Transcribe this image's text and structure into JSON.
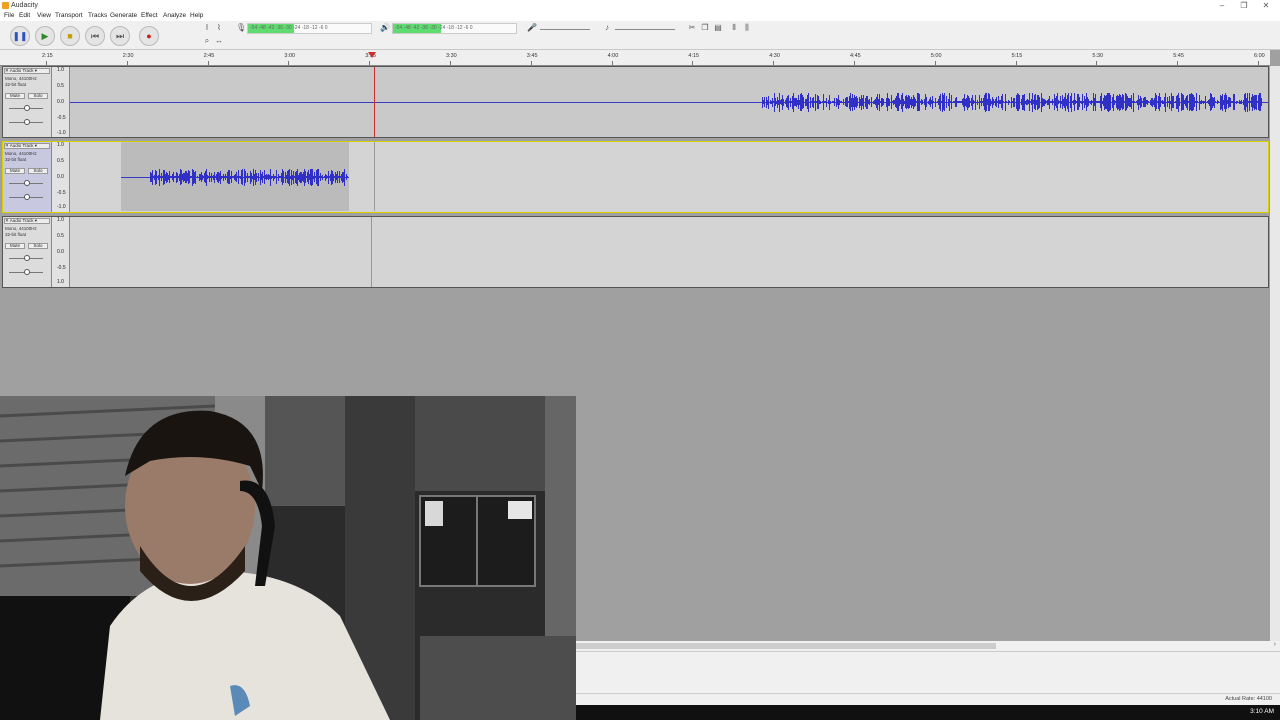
{
  "window": {
    "title": "Audacity",
    "controls": [
      "–",
      "❐",
      "✕"
    ]
  },
  "menu": [
    "File",
    "Edit",
    "View",
    "Transport",
    "Tracks",
    "Generate",
    "Effect",
    "Analyze",
    "Help"
  ],
  "toolbar": {
    "pause": "❚❚",
    "play": "▶",
    "stop": "■",
    "skip_start": "⏮",
    "skip_end": "⏭",
    "record": "●",
    "record_meter_scale": "-54 -48 -42 -36 -30 -24 -18 -12 -6 0",
    "play_meter_scale": "-54 -48 -42 -36 -30 -24 -18 -12 -6 0",
    "colors": {
      "meter_green": "#5fdc6f",
      "record_red": "#c82020"
    }
  },
  "ruler": {
    "labels": [
      "2:15",
      "2:30",
      "2:45",
      "3:00",
      "3:15",
      "3:30",
      "3:45",
      "4:00",
      "4:15",
      "4:30",
      "4:45",
      "5:00",
      "5:15",
      "5:30",
      "5:45",
      "6:00"
    ]
  },
  "tracks": [
    {
      "name": "Audio Track",
      "info1": "Mono, 44100Hz",
      "info2": "32-bit float",
      "mute": "Mute",
      "solo": "Solo",
      "scale": [
        "1.0",
        "0.5",
        "0.0",
        "-0.5",
        "-1.0"
      ]
    },
    {
      "name": "Audio Track",
      "info1": "Mono, 44100Hz",
      "info2": "32-bit float",
      "mute": "Mute",
      "solo": "Solo",
      "scale": [
        "1.0",
        "0.5",
        "0.0",
        "-0.5",
        "-1.0"
      ]
    },
    {
      "name": "Audio Track",
      "info1": "Mono, 44100Hz",
      "info2": "32-bit float",
      "mute": "Mute",
      "solo": "Solo",
      "scale": [
        "1.0",
        "0.5",
        "0.0",
        "-0.5",
        "1.0"
      ]
    }
  ],
  "status": {
    "actual_rate": "Actual Rate: 44100"
  },
  "taskbar": {
    "clock": "3:10 AM"
  }
}
